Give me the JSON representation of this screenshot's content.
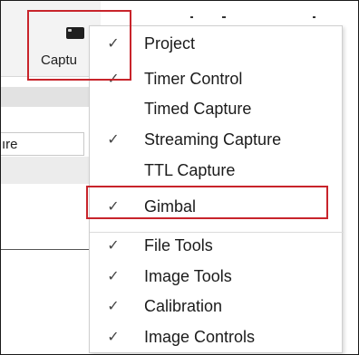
{
  "toolbar": {
    "capture_label": "Captu",
    "field_value": "ıre"
  },
  "menu": {
    "items": [
      {
        "label": "Project",
        "checked": true
      },
      {
        "label": "Timer Control",
        "checked": true
      },
      {
        "label": "Timed Capture",
        "checked": false
      },
      {
        "label": "Streaming Capture",
        "checked": true
      },
      {
        "label": "TTL Capture",
        "checked": false
      },
      {
        "label": "Gimbal",
        "checked": true
      },
      {
        "label": "File Tools",
        "checked": true
      },
      {
        "label": "Image Tools",
        "checked": true
      },
      {
        "label": "Calibration",
        "checked": true
      },
      {
        "label": "Image Controls",
        "checked": true
      }
    ],
    "check_glyph": "✓"
  },
  "colors": {
    "highlight": "#c8242b",
    "menu_bg": "#ffffff",
    "toolbar_bg": "#f3f3f3"
  }
}
